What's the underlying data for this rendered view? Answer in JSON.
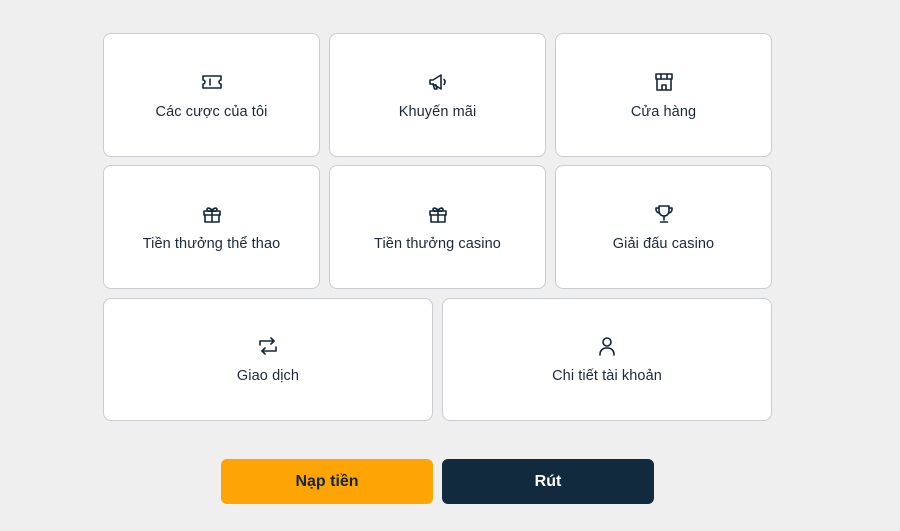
{
  "menu": {
    "items": [
      {
        "label": "Các cược của tôi",
        "icon": "ticket-icon"
      },
      {
        "label": "Khuyến mãi",
        "icon": "megaphone-icon"
      },
      {
        "label": "Cửa hàng",
        "icon": "store-icon"
      },
      {
        "label": "Tiền thưởng thể thao",
        "icon": "gift-icon"
      },
      {
        "label": "Tiền thưởng casino",
        "icon": "gift-icon"
      },
      {
        "label": "Giải đấu casino",
        "icon": "trophy-icon"
      },
      {
        "label": "Giao dịch",
        "icon": "transfer-icon"
      },
      {
        "label": "Chi tiết tài khoản",
        "icon": "user-icon"
      }
    ]
  },
  "actions": {
    "deposit_label": "Nạp tiền",
    "withdraw_label": "Rút"
  },
  "colors": {
    "background": "#efefef",
    "tile": "#ffffff",
    "text": "#12263a",
    "deposit": "#ffa405",
    "withdraw": "#122a3e"
  }
}
